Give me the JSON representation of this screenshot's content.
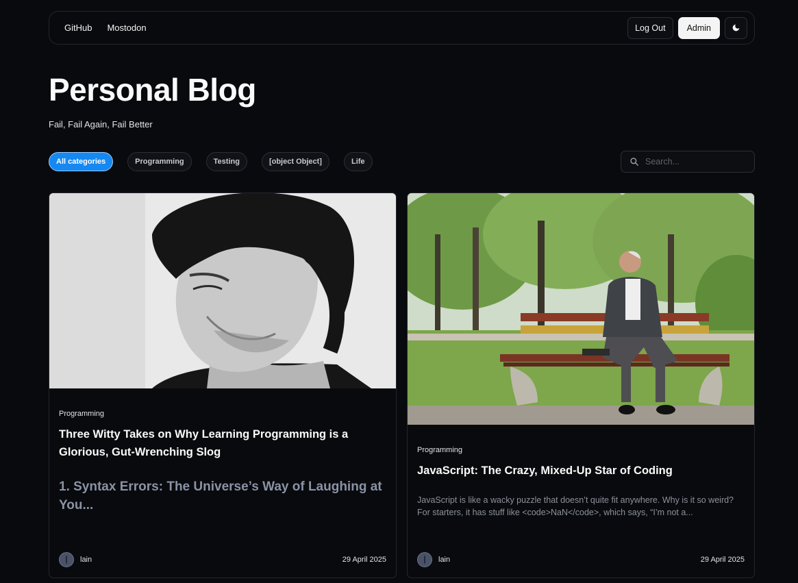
{
  "nav": {
    "links": [
      "GitHub",
      "Mostodon"
    ],
    "logout_label": "Log Out",
    "admin_label": "Admin",
    "theme_icon": "moon-icon"
  },
  "header": {
    "title": "Personal Blog",
    "subtitle": "Fail, Fail Again, Fail Better"
  },
  "categories": {
    "items": [
      "All categories",
      "Programming",
      "Testing",
      "[object Object]",
      "Life"
    ],
    "active": "All categories"
  },
  "search": {
    "placeholder": "Search..."
  },
  "posts": [
    {
      "category": "Programming",
      "title": "Three Witty Takes on Why Learning Programming is a Glorious, Gut-Wrenching Slog",
      "excerpt": "1. Syntax Errors: The Universe’s Way of Laughing at You...",
      "author": "lain",
      "date": "29 April 2025"
    },
    {
      "category": "Programming",
      "title": "JavaScript: The Crazy, Mixed-Up Star of Coding",
      "excerpt": "JavaScript is like a wacky puzzle that doesn’t quite fit anywhere. Why is it so weird? For starters, it has stuff like <code>NaN</code>, which says, “I’m not a...",
      "author": "lain",
      "date": "29 April 2025"
    }
  ],
  "colors": {
    "background": "#090a0d",
    "accent": "#1688f2",
    "border": "#24262c"
  }
}
